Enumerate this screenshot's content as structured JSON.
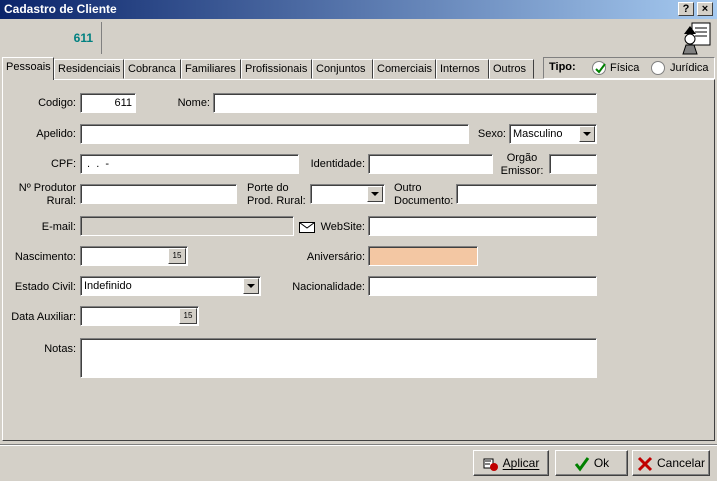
{
  "window": {
    "title": "Cadastro de Cliente",
    "help_label": "?",
    "close_label": "×"
  },
  "record": {
    "number": "611"
  },
  "tabs": [
    {
      "label": "Pessoais"
    },
    {
      "label": "Residenciais"
    },
    {
      "label": "Cobranca"
    },
    {
      "label": "Familiares"
    },
    {
      "label": "Profissionais"
    },
    {
      "label": "Conjuntos"
    },
    {
      "label": "Comerciais"
    },
    {
      "label": "Internos"
    },
    {
      "label": "Outros"
    }
  ],
  "tipo": {
    "label": "Tipo:",
    "fisica": "Física",
    "juridica": "Jurídica",
    "selected": "Física"
  },
  "form": {
    "codigo_label": "Codigo:",
    "codigo_value": "611",
    "nome_label": "Nome:",
    "nome_value": "",
    "apelido_label": "Apelido:",
    "apelido_value": "",
    "sexo_label": "Sexo:",
    "sexo_value": "Masculino",
    "cpf_label": "CPF:",
    "cpf_value": " .  .  -",
    "identidade_label": "Identidade:",
    "identidade_value": "",
    "orgao_label_1": "Orgão",
    "orgao_label_2": "Emissor:",
    "orgao_value": "",
    "produtor_label_1": "Nº Produtor",
    "produtor_label_2": "Rural:",
    "produtor_value": "",
    "porte_label_1": "Porte do",
    "porte_label_2": "Prod. Rural:",
    "porte_value": "",
    "outro_label_1": "Outro",
    "outro_label_2": "Documento:",
    "outro_value": "",
    "email_label": "E-mail:",
    "email_value": "",
    "website_label": "WebSite:",
    "website_value": "",
    "nascimento_label": "Nascimento:",
    "nascimento_value": "",
    "aniversario_label": "Aniversário:",
    "aniversario_value": "",
    "estado_civil_label": "Estado Civil:",
    "estado_civil_value": "Indefinido",
    "nacionalidade_label": "Nacionalidade:",
    "nacionalidade_value": "",
    "data_auxiliar_label": "Data Auxiliar:",
    "data_auxiliar_value": "",
    "notas_label": "Notas:",
    "notas_value": "",
    "calendar_label": "15"
  },
  "buttons": {
    "aplicar": "Aplicar",
    "ok": "Ok",
    "cancelar": "Cancelar"
  },
  "colors": {
    "title_start": "#0a246a",
    "record_number": "#008080",
    "aniversario_bg": "#f3c7a3"
  }
}
